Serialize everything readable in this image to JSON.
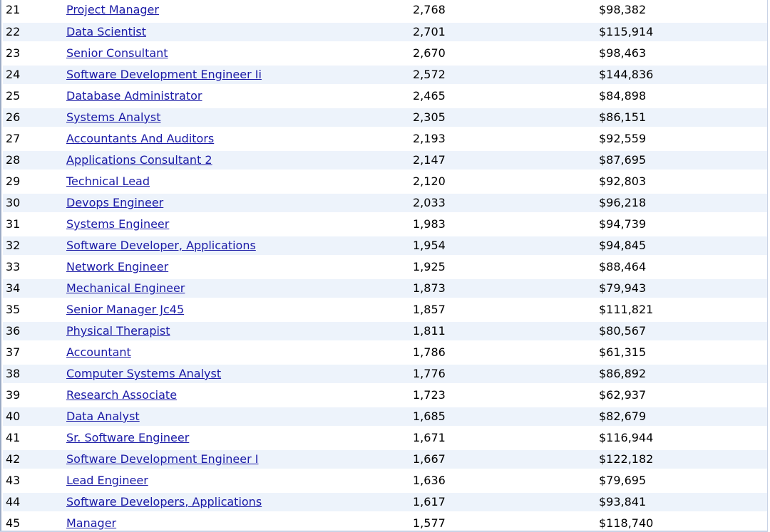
{
  "table": {
    "rows": [
      {
        "rank": "21",
        "title": "Project Manager",
        "count": "2,768",
        "salary": "$98,382"
      },
      {
        "rank": "22",
        "title": "Data Scientist",
        "count": "2,701",
        "salary": "$115,914"
      },
      {
        "rank": "23",
        "title": "Senior Consultant",
        "count": "2,670",
        "salary": "$98,463"
      },
      {
        "rank": "24",
        "title": "Software Development Engineer Ii",
        "count": "2,572",
        "salary": "$144,836"
      },
      {
        "rank": "25",
        "title": "Database Administrator",
        "count": "2,465",
        "salary": "$84,898"
      },
      {
        "rank": "26",
        "title": "Systems Analyst",
        "count": "2,305",
        "salary": "$86,151"
      },
      {
        "rank": "27",
        "title": "Accountants And Auditors",
        "count": "2,193",
        "salary": "$92,559"
      },
      {
        "rank": "28",
        "title": "Applications Consultant 2",
        "count": "2,147",
        "salary": "$87,695"
      },
      {
        "rank": "29",
        "title": "Technical Lead",
        "count": "2,120",
        "salary": "$92,803"
      },
      {
        "rank": "30",
        "title": "Devops Engineer",
        "count": "2,033",
        "salary": "$96,218"
      },
      {
        "rank": "31",
        "title": "Systems Engineer",
        "count": "1,983",
        "salary": "$94,739"
      },
      {
        "rank": "32",
        "title": "Software Developer, Applications",
        "count": "1,954",
        "salary": "$94,845"
      },
      {
        "rank": "33",
        "title": "Network Engineer",
        "count": "1,925",
        "salary": "$88,464"
      },
      {
        "rank": "34",
        "title": "Mechanical Engineer",
        "count": "1,873",
        "salary": "$79,943"
      },
      {
        "rank": "35",
        "title": "Senior Manager Jc45",
        "count": "1,857",
        "salary": "$111,821"
      },
      {
        "rank": "36",
        "title": "Physical Therapist",
        "count": "1,811",
        "salary": "$80,567"
      },
      {
        "rank": "37",
        "title": "Accountant",
        "count": "1,786",
        "salary": "$61,315"
      },
      {
        "rank": "38",
        "title": "Computer Systems Analyst",
        "count": "1,776",
        "salary": "$86,892"
      },
      {
        "rank": "39",
        "title": "Research Associate",
        "count": "1,723",
        "salary": "$62,937"
      },
      {
        "rank": "40",
        "title": "Data Analyst",
        "count": "1,685",
        "salary": "$82,679"
      },
      {
        "rank": "41",
        "title": "Sr. Software Engineer",
        "count": "1,671",
        "salary": "$116,944"
      },
      {
        "rank": "42",
        "title": "Software Development Engineer I",
        "count": "1,667",
        "salary": "$122,182"
      },
      {
        "rank": "43",
        "title": "Lead Engineer",
        "count": "1,636",
        "salary": "$79,695"
      },
      {
        "rank": "44",
        "title": "Software Developers, Applications",
        "count": "1,617",
        "salary": "$93,841"
      },
      {
        "rank": "45",
        "title": "Manager",
        "count": "1,577",
        "salary": "$118,740"
      }
    ]
  },
  "colors": {
    "link": "#1a1aa6",
    "row_stripe": "#edf3fb",
    "row_plain": "#ffffff",
    "frame_border": "#9aa9c4"
  }
}
